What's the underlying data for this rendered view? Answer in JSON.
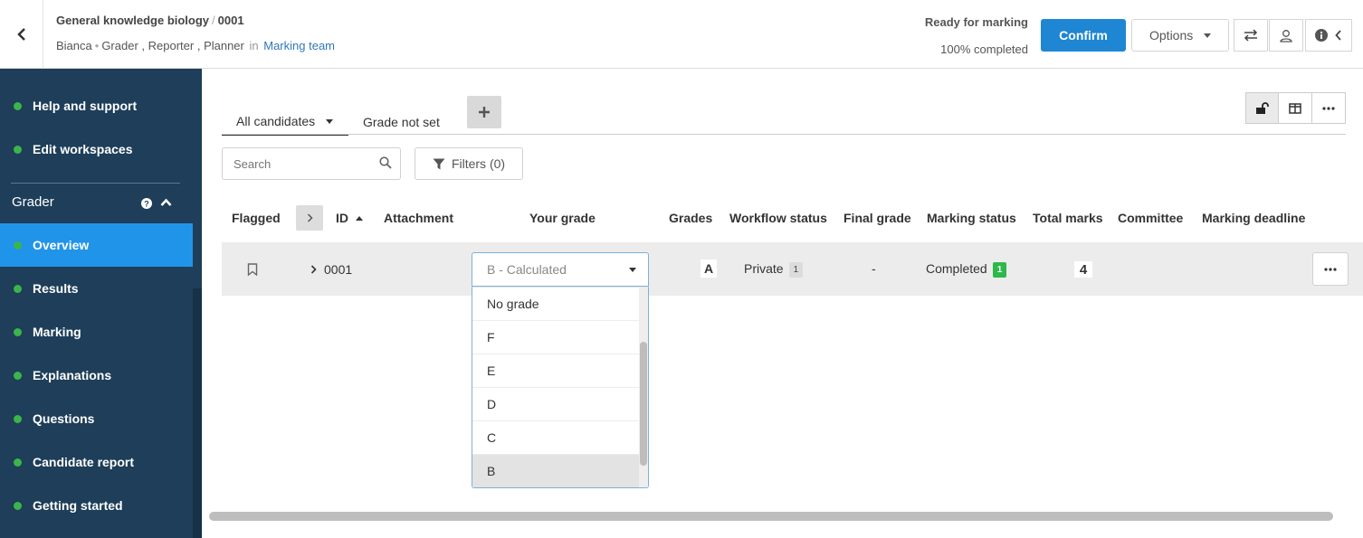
{
  "header": {
    "course": "General knowledge biology",
    "separator": "/",
    "candidate_id": "0001",
    "user": "Bianca",
    "roles": [
      "Grader ,",
      "Reporter ,",
      "Planner"
    ],
    "bullet": "•",
    "in_word": "in",
    "team_link": "Marking team",
    "status_title": "Ready for marking",
    "status_progress": "100% completed",
    "confirm_label": "Confirm",
    "options_label": "Options"
  },
  "sidebar": {
    "top_items": [
      {
        "label": "Help and support"
      },
      {
        "label": "Edit workspaces"
      }
    ],
    "section_label": "Grader",
    "items": [
      {
        "label": "Overview",
        "active": true
      },
      {
        "label": "Results"
      },
      {
        "label": "Marking"
      },
      {
        "label": "Explanations"
      },
      {
        "label": "Questions"
      },
      {
        "label": "Candidate report"
      },
      {
        "label": "Getting started"
      }
    ]
  },
  "tabs": [
    {
      "label": "All candidates",
      "active": true
    },
    {
      "label": "Grade not set"
    }
  ],
  "search": {
    "placeholder": "Search"
  },
  "filters_label": "Filters (0)",
  "columns": {
    "flagged": "Flagged",
    "id": "ID",
    "attachment": "Attachment",
    "your_grade": "Your grade",
    "grades": "Grades",
    "workflow_status": "Workflow status",
    "final_grade": "Final grade",
    "marking_status": "Marking status",
    "total_marks": "Total marks",
    "committee": "Committee",
    "marking_deadline": "Marking deadline"
  },
  "row": {
    "id": "0001",
    "grade_selected": "B - Calculated",
    "grades": "A",
    "workflow_status": "Private",
    "workflow_count": "1",
    "final_grade": "-",
    "marking_status": "Completed",
    "marking_count": "1",
    "total_marks": "4"
  },
  "grade_options": [
    "No grade",
    "F",
    "E",
    "D",
    "C",
    "B"
  ],
  "highlighted_option": "B",
  "colors": {
    "sidebar_bg": "#1e3e59",
    "active_item": "#2094e8",
    "status_dot": "#3bb54a",
    "confirm_bg": "#1f86d3",
    "link": "#2f78b7",
    "completed_badge": "#2eb84b"
  }
}
